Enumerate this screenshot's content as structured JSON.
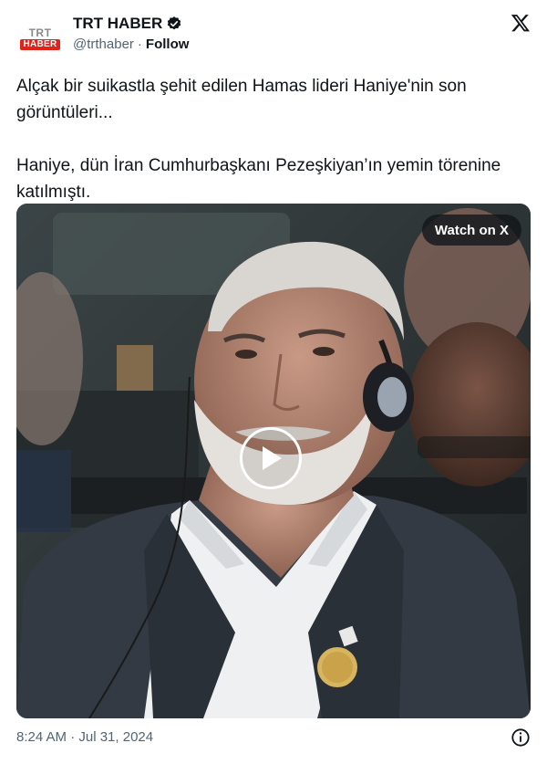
{
  "account": {
    "logo_top": "TRT",
    "logo_bottom": "HABER",
    "display_name": "TRT HABER",
    "handle": "@trthaber",
    "separator": "·",
    "follow_label": "Follow"
  },
  "tweet": {
    "paragraph_1": "Alçak bir suikastla şehit edilen Hamas lideri Haniye'nin son görüntüleri...",
    "paragraph_2": "Haniye, dün İran Cumhurbaşkanı Pezeşkiyan’ın yemin törenine katılmıştı."
  },
  "media": {
    "watch_label": "Watch on X"
  },
  "footer": {
    "timestamp": "8:24 AM · Jul 31, 2024"
  },
  "icons": {
    "verified": "verified-badge-icon",
    "platform": "x-logo-icon",
    "play": "play-icon",
    "info": "info-icon"
  },
  "colors": {
    "text": "#0f1419",
    "secondary": "#536471",
    "logo_red": "#e2231a"
  }
}
